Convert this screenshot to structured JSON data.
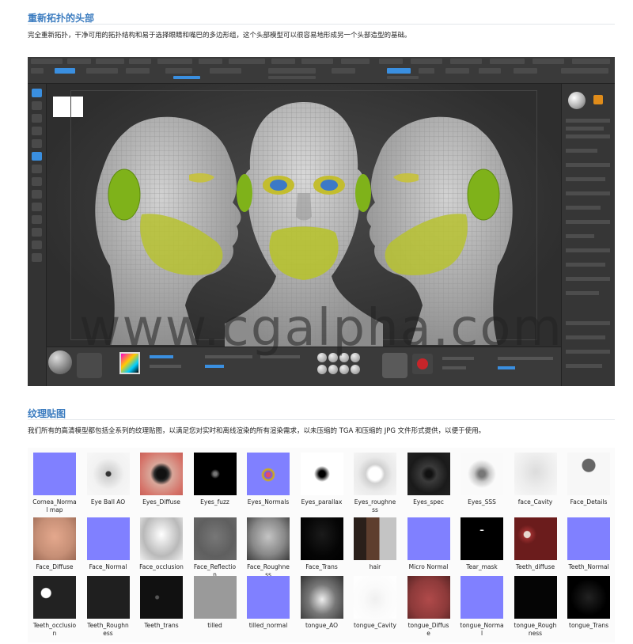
{
  "section1": {
    "title": "重新拓扑的头部",
    "description": "完全重新拓扑，干净可用的拓扑结构和易于选择眼睛和嘴巴的多边形组，这个头部模型可以很容易地形成另一个头部造型的基础。"
  },
  "viewer": {
    "watermark": "www.cgalpha.com"
  },
  "section2": {
    "title": "纹理贴图",
    "description": "我们所有的高清模型都包括全系列的纹理贴图，以满足您对实时和离线渲染的所有渲染需求，以未压缩的 TGA 和压缩的 JPG 文件形式提供，以便于使用。"
  },
  "textures": [
    {
      "label": "Cornea_Normal map",
      "kind": "normal"
    },
    {
      "label": "Eye Ball AO",
      "kind": "eyeao"
    },
    {
      "label": "Eyes_Diffuse",
      "kind": "eyediffuse"
    },
    {
      "label": "Eyes_fuzz",
      "kind": "fuzz"
    },
    {
      "label": "Eyes_Normals",
      "kind": "eyenormal"
    },
    {
      "label": "Eyes_parallax",
      "kind": "parallax"
    },
    {
      "label": "Eyes_roughness",
      "kind": "eyerough"
    },
    {
      "label": "Eyes_spec",
      "kind": "eyespec"
    },
    {
      "label": "Eyes_SSS",
      "kind": "sss"
    },
    {
      "label": "face_Cavity",
      "kind": "cavity"
    },
    {
      "label": "Face_Details",
      "kind": "details"
    },
    {
      "label": "Face_Diffuse",
      "kind": "facediffuse"
    },
    {
      "label": "Face_Normal",
      "kind": "normal"
    },
    {
      "label": "Face_occlusion",
      "kind": "occlusion"
    },
    {
      "label": "Face_Reflection",
      "kind": "reflection"
    },
    {
      "label": "Face_Roughness",
      "kind": "roughness"
    },
    {
      "label": "Face_Trans",
      "kind": "trans"
    },
    {
      "label": "hair",
      "kind": "hair"
    },
    {
      "label": "Micro Normal",
      "kind": "normal"
    },
    {
      "label": "Tear_mask",
      "kind": "tear"
    },
    {
      "label": "Teeth_diffuse",
      "kind": "teethdiffuse"
    },
    {
      "label": "Teeth_Normal",
      "kind": "normal"
    },
    {
      "label": "Teeth_occlusion",
      "kind": "teethocc"
    },
    {
      "label": "Teeth_Roughness",
      "kind": "dark"
    },
    {
      "label": "Teeth_trans",
      "kind": "teethtrans"
    },
    {
      "label": "tilled",
      "kind": "gray"
    },
    {
      "label": "tilled_normal",
      "kind": "normal"
    },
    {
      "label": "tongue_AO",
      "kind": "tongueao"
    },
    {
      "label": "tongue_Cavity",
      "kind": "tonguecav"
    },
    {
      "label": "tongue_Diffuse",
      "kind": "tonguediff"
    },
    {
      "label": "tongue_Normal",
      "kind": "normal"
    },
    {
      "label": "tongue_Roughness",
      "kind": "black"
    },
    {
      "label": "tongue_Trans",
      "kind": "black2"
    }
  ]
}
